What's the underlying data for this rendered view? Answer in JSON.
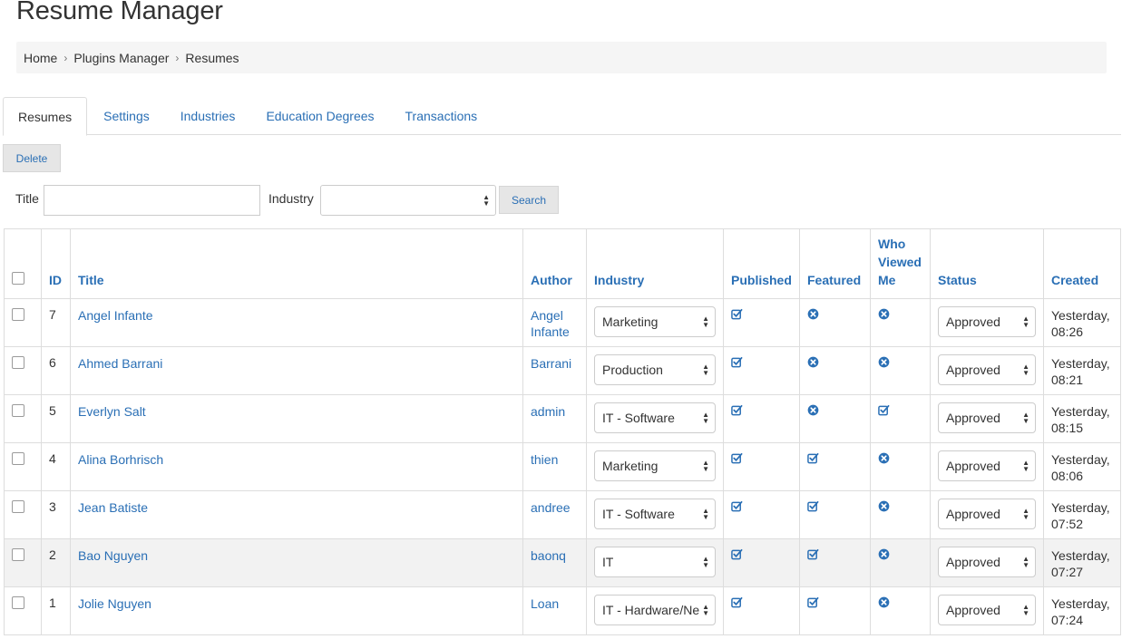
{
  "page": {
    "title": "Resume Manager"
  },
  "breadcrumb": [
    {
      "label": "Home"
    },
    {
      "label": "Plugins Manager"
    },
    {
      "label": "Resumes"
    }
  ],
  "tabs": [
    "Resumes",
    "Settings",
    "Industries",
    "Education Degrees",
    "Transactions"
  ],
  "toolbar": {
    "delete_label": "Delete",
    "search_label": "Search"
  },
  "filters": {
    "title_label": "Title",
    "title_value": "",
    "industry_label": "Industry",
    "industry_value": ""
  },
  "table": {
    "headers": [
      "ID",
      "Title",
      "Author",
      "Industry",
      "Published",
      "Featured",
      "Who Viewed Me",
      "Status",
      "Created"
    ],
    "rows": [
      {
        "id": "7",
        "title": "Angel Infante",
        "author": "Angel Infante",
        "industry": "Marketing",
        "published": "check",
        "featured": "cross",
        "who_viewed": "cross",
        "status": "Approved",
        "created": "Yesterday, 08:26"
      },
      {
        "id": "6",
        "title": "Ahmed Barrani",
        "author": "Barrani",
        "industry": "Production",
        "published": "check",
        "featured": "cross",
        "who_viewed": "cross",
        "status": "Approved",
        "created": "Yesterday, 08:21"
      },
      {
        "id": "5",
        "title": "Everlyn Salt",
        "author": "admin",
        "industry": "IT - Software",
        "published": "check",
        "featured": "cross",
        "who_viewed": "check",
        "status": "Approved",
        "created": "Yesterday, 08:15"
      },
      {
        "id": "4",
        "title": "Alina Borhrisch",
        "author": "thien",
        "industry": "Marketing",
        "published": "check",
        "featured": "check",
        "who_viewed": "cross",
        "status": "Approved",
        "created": "Yesterday, 08:06"
      },
      {
        "id": "3",
        "title": "Jean Batiste",
        "author": "andree",
        "industry": "IT - Software",
        "published": "check",
        "featured": "check",
        "who_viewed": "cross",
        "status": "Approved",
        "created": "Yesterday, 07:52"
      },
      {
        "id": "2",
        "title": "Bao Nguyen",
        "author": "baonq",
        "industry": "IT",
        "published": "check",
        "featured": "check",
        "who_viewed": "cross",
        "status": "Approved",
        "created": "Yesterday, 07:27",
        "highlighted": true
      },
      {
        "id": "1",
        "title": "Jolie Nguyen",
        "author": "Loan",
        "industry": "IT - Hardware/Ne",
        "published": "check",
        "featured": "check",
        "who_viewed": "cross",
        "status": "Approved",
        "created": "Yesterday, 07:24"
      }
    ]
  },
  "colors": {
    "link": "#2a6fb5",
    "border": "#dddddd",
    "breadcrumb_bg": "#f5f5f5",
    "highlight_row": "#f2f2f2"
  }
}
